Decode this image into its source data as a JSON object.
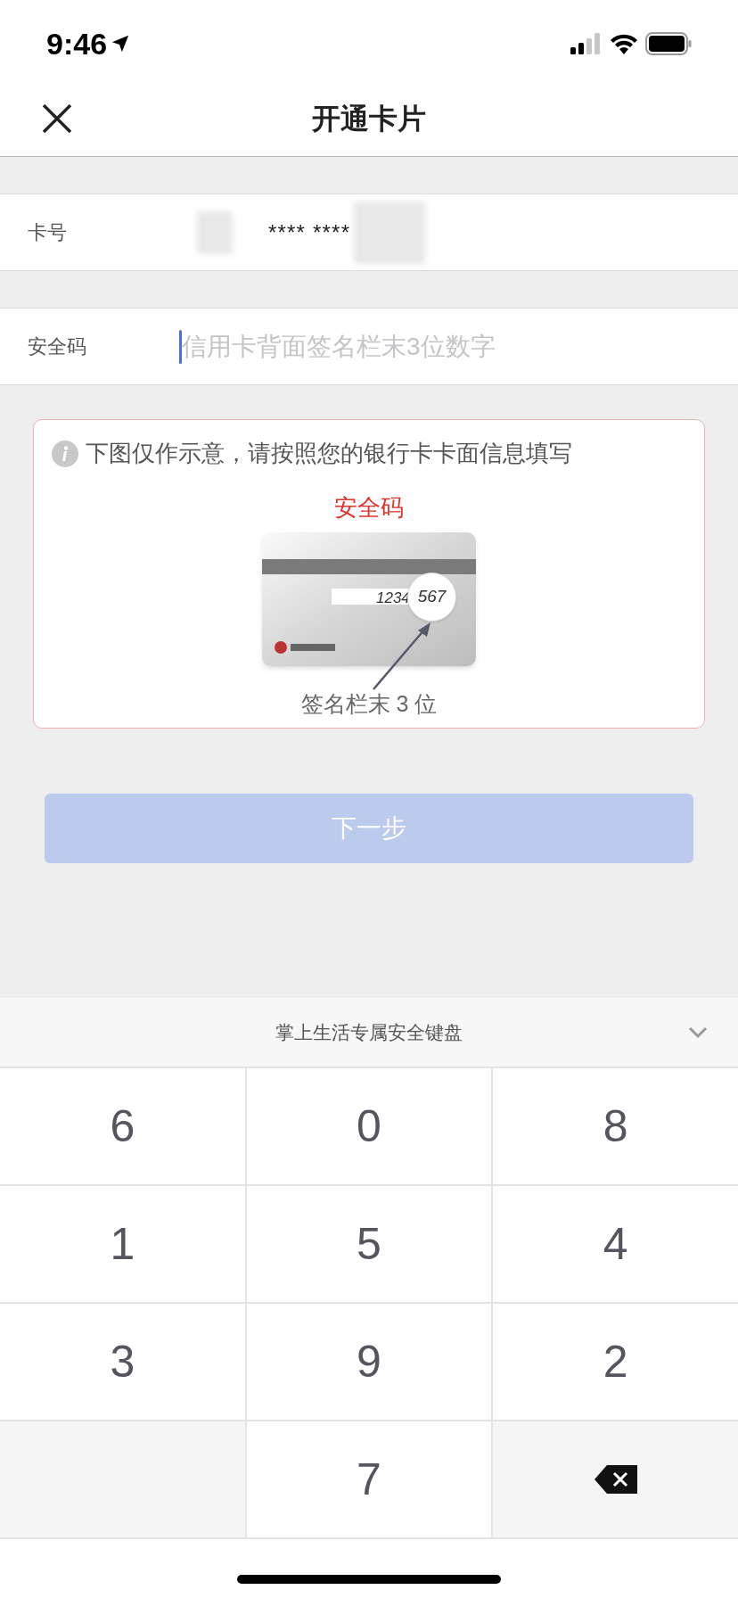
{
  "status_bar": {
    "time": "9:46"
  },
  "nav": {
    "title": "开通卡片"
  },
  "form": {
    "rows": [
      {
        "label": "卡号",
        "value": "**** ****"
      },
      {
        "label": "安全码",
        "placeholder": "信用卡背面签名栏末3位数字",
        "focused": true
      }
    ]
  },
  "tip": {
    "text": "下图仅作示意，请按照您的银行卡卡面信息填写",
    "heading": "安全码",
    "card_digits": "1234",
    "card_code": "567",
    "caption": "签名栏末 3 位"
  },
  "next_button": {
    "label": "下一步",
    "disabled": true
  },
  "keyboard": {
    "title": "掌上生活专属安全键盘",
    "keys": [
      {
        "kind": "digit",
        "label": "6"
      },
      {
        "kind": "digit",
        "label": "0"
      },
      {
        "kind": "digit",
        "label": "8"
      },
      {
        "kind": "digit",
        "label": "1"
      },
      {
        "kind": "digit",
        "label": "5"
      },
      {
        "kind": "digit",
        "label": "4"
      },
      {
        "kind": "digit",
        "label": "3"
      },
      {
        "kind": "digit",
        "label": "9"
      },
      {
        "kind": "digit",
        "label": "2"
      },
      {
        "kind": "blank"
      },
      {
        "kind": "digit",
        "label": "7"
      },
      {
        "kind": "delete"
      }
    ]
  }
}
